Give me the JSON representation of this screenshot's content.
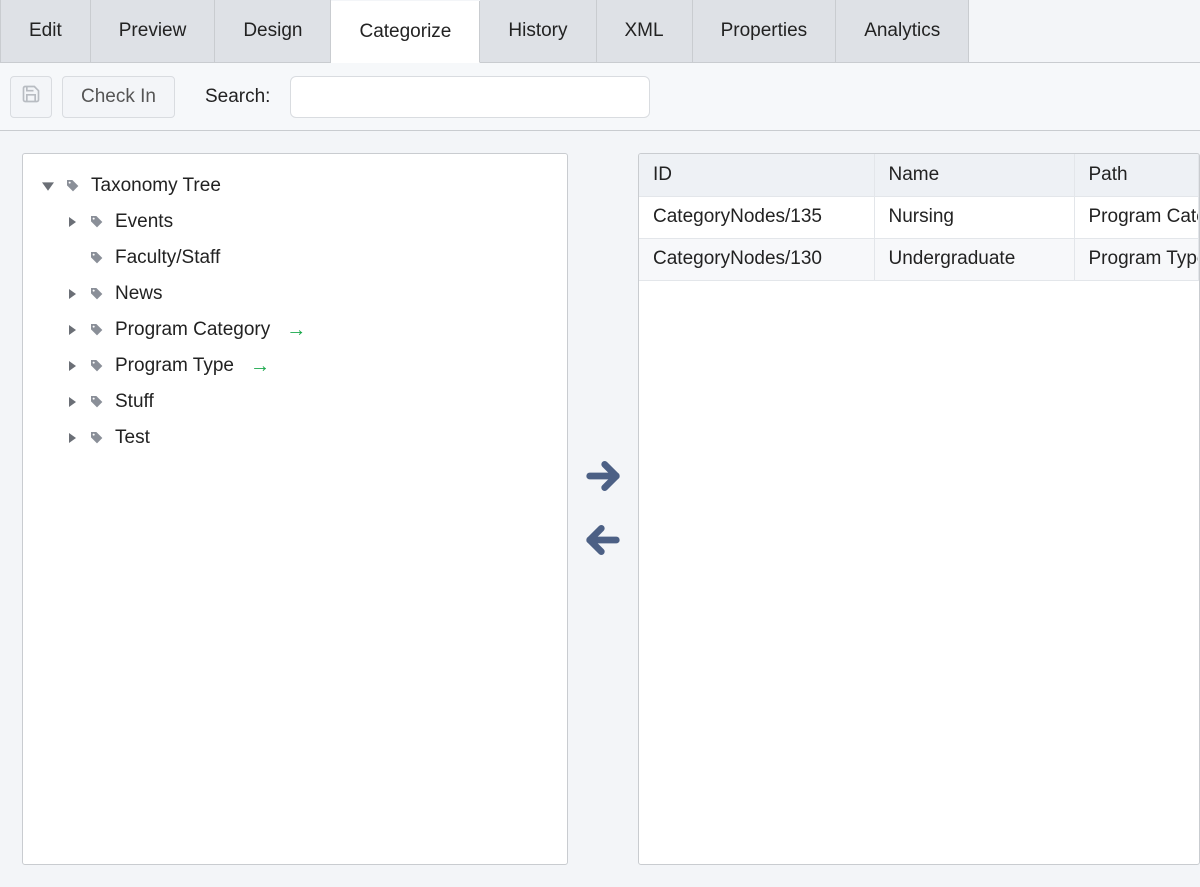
{
  "tabs": [
    {
      "label": "Edit"
    },
    {
      "label": "Preview"
    },
    {
      "label": "Design"
    },
    {
      "label": "Categorize",
      "active": true
    },
    {
      "label": "History"
    },
    {
      "label": "XML"
    },
    {
      "label": "Properties"
    },
    {
      "label": "Analytics"
    }
  ],
  "toolbar": {
    "checkin_label": "Check In",
    "search_label": "Search:",
    "search_value": ""
  },
  "tree": {
    "root_label": "Taxonomy Tree",
    "items": [
      {
        "label": "Events",
        "has_children": true,
        "linked": false
      },
      {
        "label": "Faculty/Staff",
        "has_children": false,
        "linked": false
      },
      {
        "label": "News",
        "has_children": true,
        "linked": false
      },
      {
        "label": "Program Category",
        "has_children": true,
        "linked": true
      },
      {
        "label": "Program Type",
        "has_children": true,
        "linked": true
      },
      {
        "label": "Stuff",
        "has_children": true,
        "linked": false
      },
      {
        "label": "Test",
        "has_children": true,
        "linked": false
      }
    ]
  },
  "table": {
    "headers": {
      "id": "ID",
      "name": "Name",
      "path": "Path"
    },
    "rows": [
      {
        "id": "CategoryNodes/135",
        "name": "Nursing",
        "path": "Program Category"
      },
      {
        "id": "CategoryNodes/130",
        "name": "Undergraduate",
        "path": "Program Type"
      }
    ]
  }
}
